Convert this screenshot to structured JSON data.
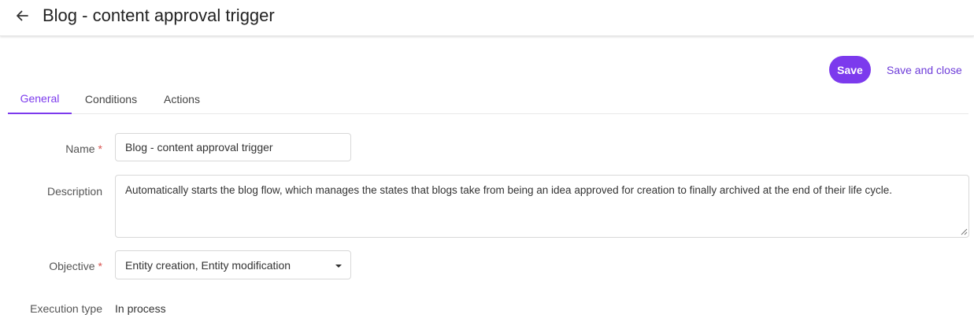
{
  "header": {
    "title": "Blog - content approval trigger",
    "back_icon": "arrow-left-icon"
  },
  "toolbar": {
    "save_label": "Save",
    "save_close_label": "Save and close"
  },
  "tabs": [
    {
      "label": "General",
      "active": true
    },
    {
      "label": "Conditions",
      "active": false
    },
    {
      "label": "Actions",
      "active": false
    }
  ],
  "form": {
    "name": {
      "label": "Name",
      "required_mark": "*",
      "value": "Blog - content approval trigger"
    },
    "description": {
      "label": "Description",
      "value": "Automatically starts the blog flow, which manages the states that blogs take from being an idea approved for creation to finally archived at the end of their life cycle."
    },
    "objective": {
      "label": "Objective",
      "required_mark": "*",
      "value": "Entity creation, Entity modification"
    },
    "execution_type": {
      "label": "Execution type",
      "value": "In process"
    }
  },
  "colors": {
    "accent": "#7c3aed",
    "required": "#d9534f"
  }
}
